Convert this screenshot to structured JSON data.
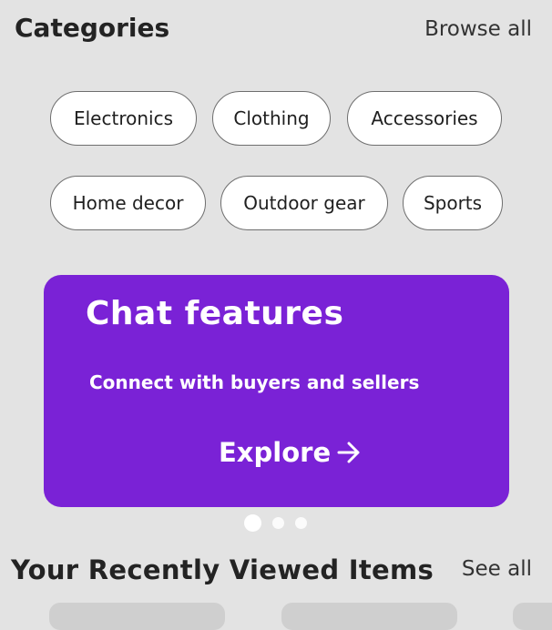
{
  "categories": {
    "title": "Categories",
    "browse_all": "Browse all",
    "chips": [
      "Electronics",
      "Clothing",
      "Accessories",
      "Home decor",
      "Outdoor gear",
      "Sports"
    ]
  },
  "promo": {
    "title": "Chat features",
    "subtitle": "Connect with buyers and sellers",
    "cta": "Explore",
    "cta_icon": "arrow-right-icon",
    "background": "#7a22d6",
    "pager": {
      "total": 3,
      "active": 1
    }
  },
  "recent": {
    "title": "Your Recently Viewed Items",
    "see_all": "See all"
  }
}
